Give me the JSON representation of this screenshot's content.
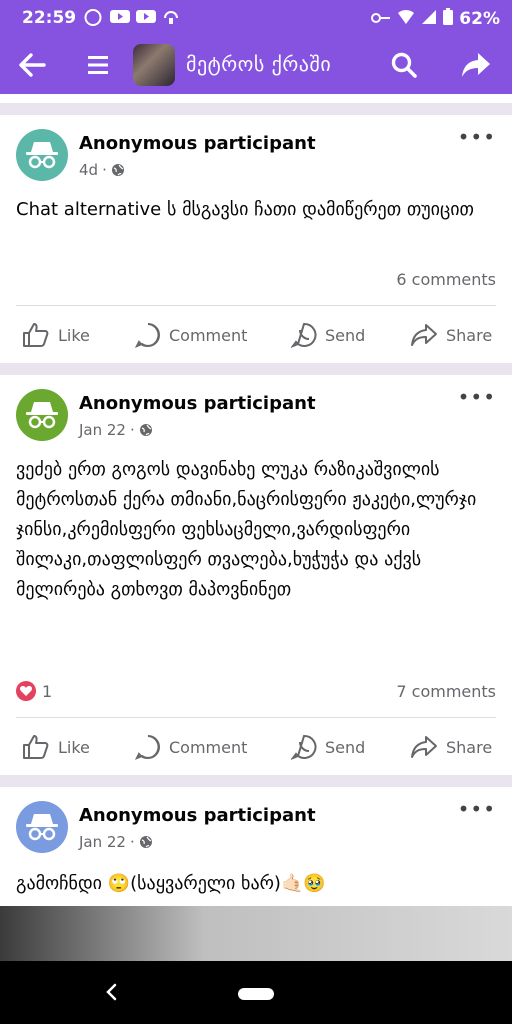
{
  "status": {
    "time": "22:59",
    "battery": "62%"
  },
  "app": {
    "title": "მეტროს ქრაში"
  },
  "posts": [
    {
      "author": "Anonymous participant",
      "time": "4d",
      "text": "Chat alternative ს მსგავსი ჩათი დამიწერეთ თუიცით",
      "comments": "6 comments",
      "avatar_color": "#5bb8a8"
    },
    {
      "author": "Anonymous participant",
      "time": "Jan 22",
      "text": "ვეძებ ერთ გოგოს დავინახე ლუკა რაზიკაშვილის მეტროსთან ქერა თმიანი,ნაცრისფერი ჟაკეტი,ლურჯი ჯინსი,კრემისფერი ფეხსაცმელი,ვარდისფერი შილაკი,თაფლისფერ თვალება,ხუჭუჭა და აქვს მელირება გთხოვთ მაპოვნინეთ",
      "reactions": "1",
      "comments": "7 comments",
      "avatar_color": "#6aa82f"
    },
    {
      "author": "Anonymous participant",
      "time": "Jan 22",
      "text": "გამოჩნდი 🙄(საყვარელი ხარ)🤙🏻🥹",
      "avatar_color": "#7a9be0"
    }
  ],
  "actions": {
    "like": "Like",
    "comment": "Comment",
    "send": "Send",
    "share": "Share"
  },
  "colors": {
    "accent": "#8553e0",
    "reaction": "#e4405f"
  }
}
